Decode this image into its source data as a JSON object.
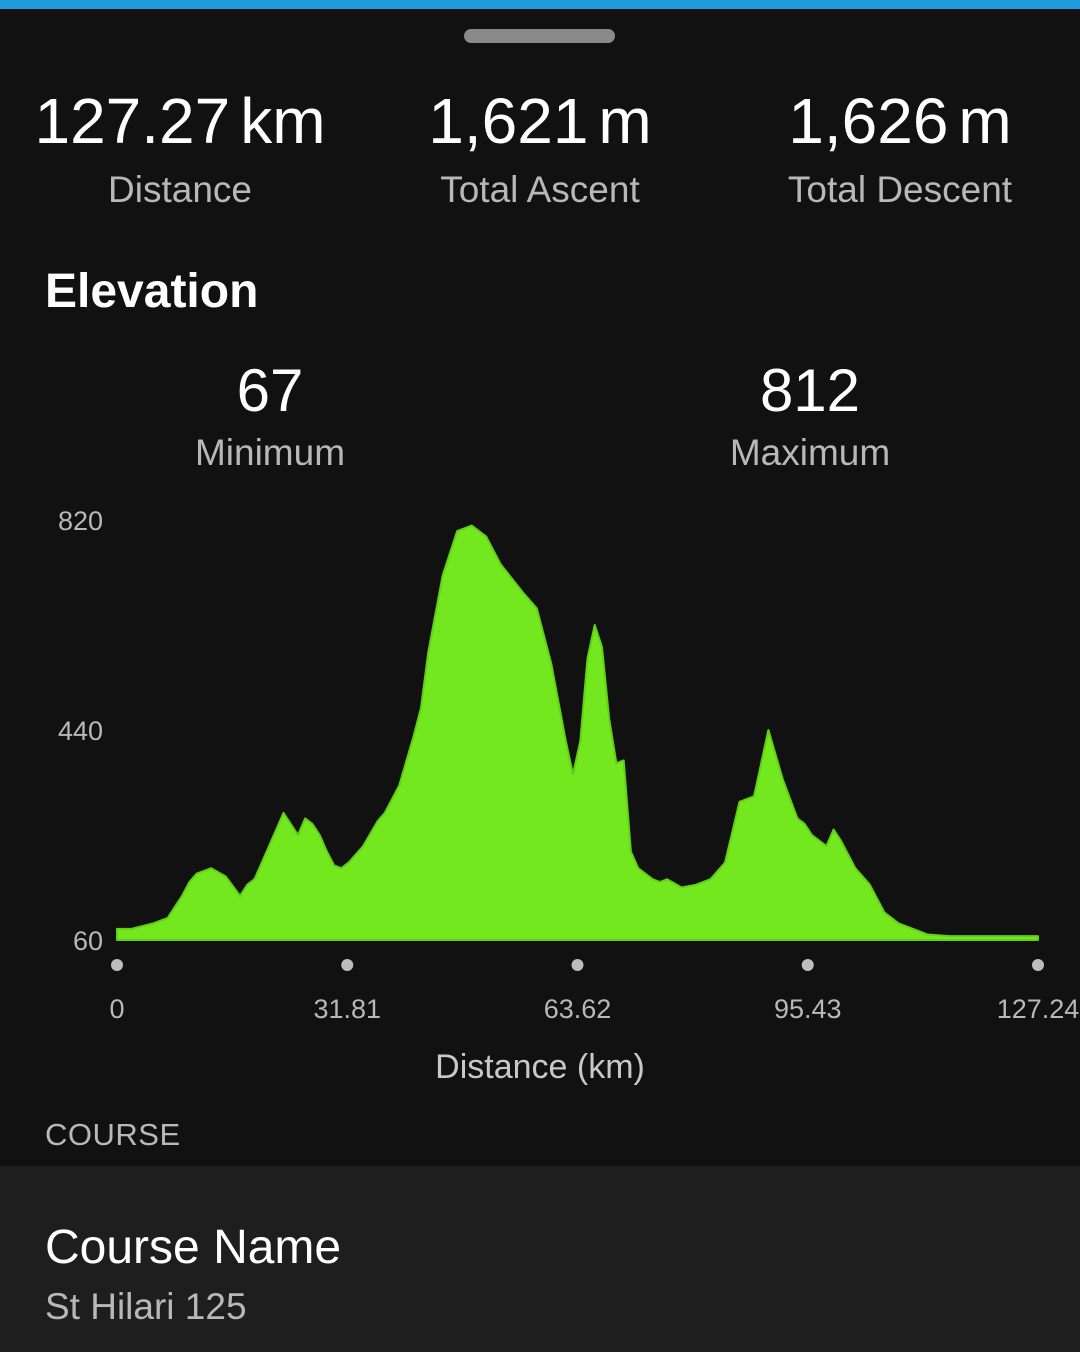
{
  "colors": {
    "accent": "#1f9be0",
    "fill": "#74e81e",
    "background": "#111111",
    "card": "#1e1e1e"
  },
  "stats": [
    {
      "value": "127.27",
      "unit": "km",
      "label": "Distance"
    },
    {
      "value": "1,621",
      "unit": "m",
      "label": "Total Ascent"
    },
    {
      "value": "1,626",
      "unit": "m",
      "label": "Total Descent"
    }
  ],
  "elevation": {
    "title": "Elevation",
    "min": {
      "value": "67",
      "label": "Minimum"
    },
    "max": {
      "value": "812",
      "label": "Maximum"
    }
  },
  "chart_data": {
    "type": "area",
    "title": "",
    "xlabel": "Distance (km)",
    "ylabel": "",
    "xlim": [
      0,
      127.24
    ],
    "ylim": [
      60,
      820
    ],
    "x_ticks": [
      "0",
      "31.81",
      "63.62",
      "95.43",
      "127.24"
    ],
    "y_ticks": [
      "820",
      "440",
      "60"
    ],
    "grid": false,
    "series": [
      {
        "x": [
          0,
          2,
          5,
          7,
          9,
          10,
          11,
          13,
          15,
          17,
          18,
          19,
          21,
          23,
          25,
          26,
          27,
          28,
          29,
          30,
          31,
          32,
          34,
          36,
          37,
          39,
          41,
          42,
          43,
          45,
          47,
          49,
          51,
          53,
          56,
          58,
          60,
          62,
          63,
          64,
          65,
          66,
          67,
          68,
          69,
          70,
          71,
          72,
          73,
          74,
          75,
          76,
          78,
          80,
          82,
          84,
          86,
          88,
          89,
          90,
          92,
          94,
          95,
          96,
          97,
          98,
          99,
          100,
          102,
          104,
          106,
          107,
          108,
          110,
          112,
          115,
          118,
          121,
          124,
          127.24
        ],
        "y": [
          80,
          80,
          90,
          100,
          140,
          165,
          180,
          190,
          175,
          140,
          160,
          170,
          230,
          290,
          250,
          280,
          270,
          250,
          220,
          195,
          190,
          200,
          230,
          275,
          290,
          340,
          430,
          480,
          580,
          720,
          800,
          810,
          790,
          740,
          690,
          660,
          560,
          420,
          360,
          420,
          570,
          630,
          590,
          460,
          380,
          385,
          220,
          190,
          180,
          170,
          165,
          170,
          155,
          160,
          170,
          200,
          310,
          320,
          380,
          440,
          350,
          280,
          270,
          250,
          240,
          230,
          260,
          240,
          190,
          160,
          110,
          100,
          90,
          80,
          70,
          67,
          67,
          67,
          67,
          67
        ]
      }
    ]
  },
  "course": {
    "section_label": "COURSE",
    "name_label": "Course Name",
    "name_value": "St Hilari 125"
  }
}
